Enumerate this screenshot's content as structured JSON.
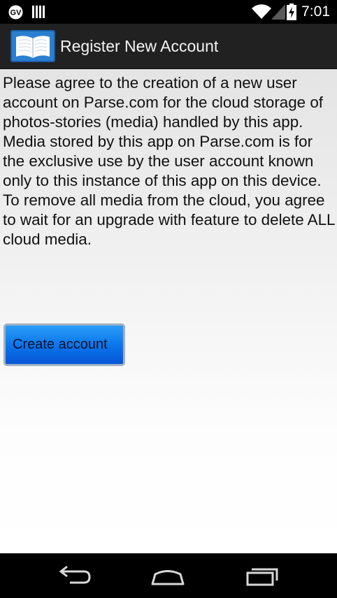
{
  "status_bar": {
    "time": "7:01",
    "notification_icons": [
      "gv-voice-icon",
      "barcode-icon"
    ],
    "system_icons": [
      "wifi-icon",
      "cell-signal-icon",
      "battery-charging-icon"
    ]
  },
  "action_bar": {
    "app_icon": "open-book-icon",
    "title": "Register New Account"
  },
  "main": {
    "message": "Please agree to the creation of a new user account on Parse.com for the cloud storage of photos-stories (media) handled by this app. Media stored by this app on Parse.com is for the exclusive use by the user account known only to this instance of this app on this device. To remove all media from the cloud, you agree to wait for an upgrade with feature to delete ALL cloud media.",
    "create_button_label": "Create account"
  },
  "nav_bar": {
    "buttons": [
      "back-icon",
      "home-icon",
      "recent-apps-icon"
    ]
  },
  "colors": {
    "button_blue": "#0a73ea",
    "action_bar": "#212121",
    "status_bar": "#000000"
  }
}
